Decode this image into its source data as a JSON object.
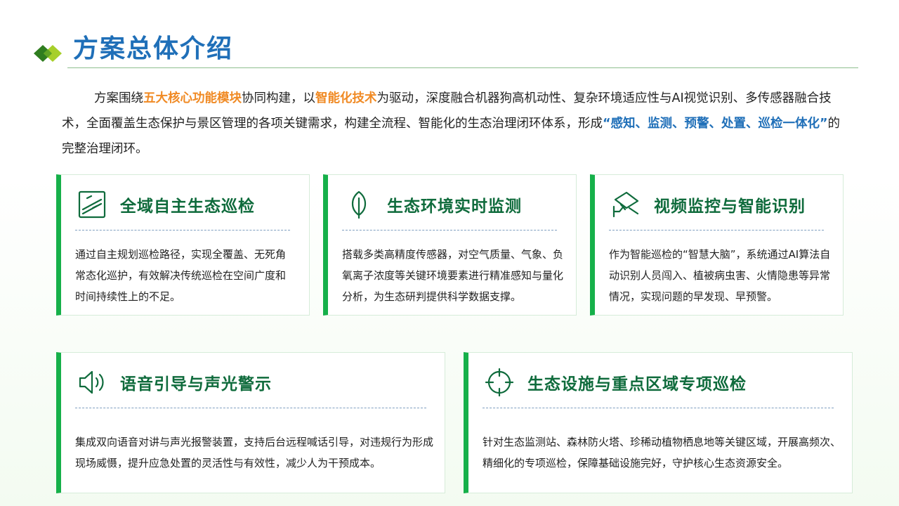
{
  "header": {
    "title": "方案总体介绍"
  },
  "intro": {
    "p1": "方案围绕",
    "h1": "五大核心功能模块",
    "p2": "协同构建，以",
    "h2": "智能化技术",
    "p3": "为驱动，深度融合机器狗高机动性、复杂环境适应性与AI视觉识别、多传感器融合技术，全面覆盖生态保护与景区管理的各项关键需求，构建全流程、智能化的生态治理闭环体系，形成",
    "h3": "“感知、监测、预警、处置、巡检一体化”",
    "p4": "的完整治理闭环。"
  },
  "cards": [
    {
      "icon": "road-patrol-icon",
      "title": "全域自主生态巡检",
      "body": "通过自主规划巡检路径，实现全覆盖、无死角常态化巡护，有效解决传统巡检在空间广度和时间持续性上的不足。"
    },
    {
      "icon": "leaf-icon",
      "title": "生态环境实时监测",
      "body": "搭载多类高精度传感器，对空气质量、气象、负氧离子浓度等关键环境要素进行精准感知与量化分析，为生态研判提供科学数据支撑。"
    },
    {
      "icon": "camera-icon",
      "title": "视频监控与智能识别",
      "body": "作为智能巡检的“智慧大脑”，系统通过AI算法自动识别人员闯入、植被病虫害、火情隐患等异常情况，实现问题的早发现、早预警。"
    },
    {
      "icon": "speaker-icon",
      "title": "语音引导与声光警示",
      "body": "集成双向语音对讲与声光报警装置，支持后台远程喊话引导，对违规行为形成现场威慑，提升应急处置的灵活性与有效性，减少人为干预成本。"
    },
    {
      "icon": "crosshair-icon",
      "title": "生态设施与重点区域专项巡检",
      "body": "针对生态监测站、森林防火塔、珍稀动植物栖息地等关键区域，开展高频次、精细化的专项巡检，保障基础设施完好，守护核心生态资源安全。"
    }
  ]
}
